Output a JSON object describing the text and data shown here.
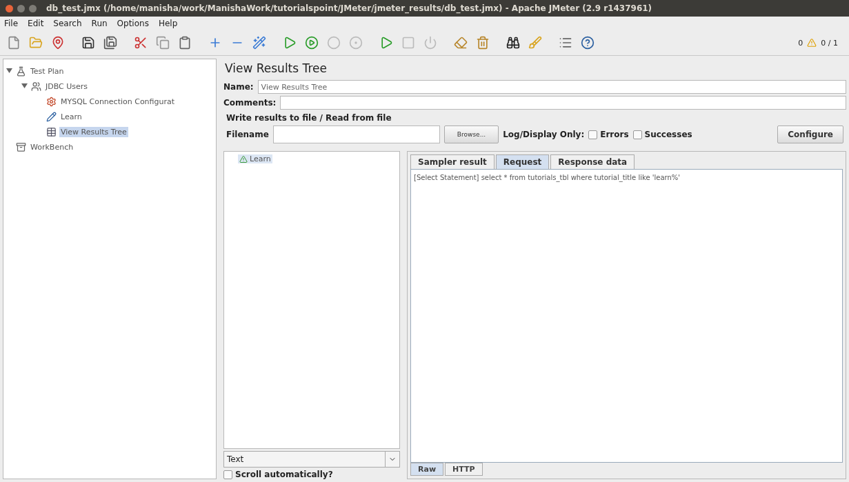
{
  "window": {
    "title": "db_test.jmx (/home/manisha/work/ManishaWork/tutorialspoint/JMeter/jmeter_results/db_test.jmx) - Apache JMeter (2.9 r1437961)"
  },
  "menu": [
    "File",
    "Edit",
    "Search",
    "Run",
    "Options",
    "Help"
  ],
  "toolbar": {
    "error_count": "0",
    "thread_count": "0 / 1"
  },
  "test_tree": [
    {
      "label": "Test Plan",
      "kind": "plan",
      "selected": false,
      "expanded": true,
      "children": [
        {
          "label": "JDBC Users",
          "kind": "threads",
          "selected": false,
          "expanded": true,
          "children": [
            {
              "label": "MYSQL Connection Configurat",
              "kind": "config",
              "selected": false
            },
            {
              "label": "Learn",
              "kind": "sampler",
              "selected": false
            },
            {
              "label": "View Results Tree",
              "kind": "listener",
              "selected": true
            }
          ]
        }
      ]
    },
    {
      "label": "WorkBench",
      "kind": "workbench",
      "selected": false
    }
  ],
  "panel": {
    "title": "View Results Tree",
    "name_label": "Name:",
    "name_value": "View Results Tree",
    "comments_label": "Comments:",
    "file_group": "Write results to file / Read from file",
    "filename_label": "Filename",
    "browse_button": "Browse...",
    "log_label": "Log/Display Only:",
    "checks": [
      {
        "label": "Errors",
        "checked": false
      },
      {
        "label": "Successes",
        "checked": false
      }
    ],
    "configure_button": "Configure"
  },
  "results": [
    {
      "label": "Learn",
      "selected": true
    }
  ],
  "renderer": {
    "value": "Text"
  },
  "scroll_auto": {
    "label": "Scroll automatically?",
    "checked": false
  },
  "tabs": [
    {
      "label": "Sampler result",
      "selected": false
    },
    {
      "label": "Request",
      "selected": true
    },
    {
      "label": "Response data",
      "selected": false
    }
  ],
  "request_text": "[Select Statement] select * from tutorials_tbl  where tutorial_title like 'learn%'",
  "bottom_tabs": [
    {
      "label": "Raw",
      "selected": true
    },
    {
      "label": "HTTP",
      "selected": false
    }
  ]
}
